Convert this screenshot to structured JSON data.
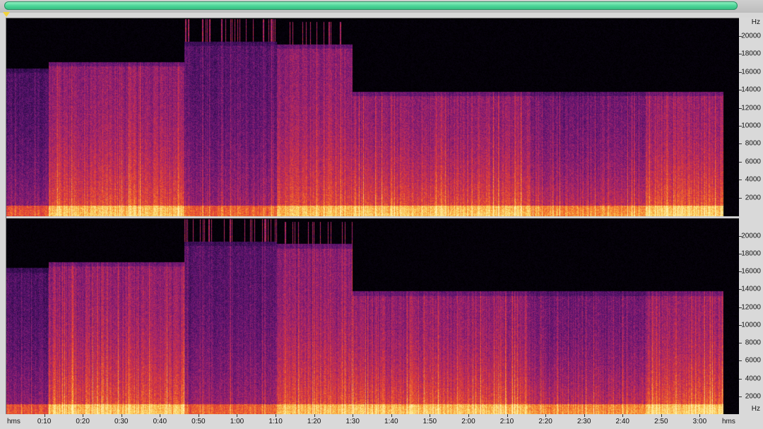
{
  "scrollbar": {
    "accent": "#49d596"
  },
  "marker_color": "#f1d23b",
  "frequency_axis": {
    "unit_label": "Hz",
    "ticks": [
      "20000",
      "18000",
      "16000",
      "14000",
      "12000",
      "10000",
      "8000",
      "6000",
      "4000",
      "2000"
    ],
    "max_hz": 22050
  },
  "time_axis": {
    "unit_label": "hms",
    "ticks": [
      "0:10",
      "0:20",
      "0:30",
      "0:40",
      "0:50",
      "1:00",
      "1:10",
      "1:20",
      "1:30",
      "1:40",
      "1:50",
      "2:00",
      "2:10",
      "2:20",
      "2:30",
      "2:40",
      "2:50",
      "3:00"
    ],
    "max_seconds": 190
  },
  "channels": [
    "channel-1",
    "channel-2"
  ],
  "palette": [
    "#000000",
    "#1f0a3c",
    "#5a1470",
    "#a0236e",
    "#dc3a3a",
    "#f57c2a",
    "#fbd05c",
    "#fff2b0"
  ]
}
